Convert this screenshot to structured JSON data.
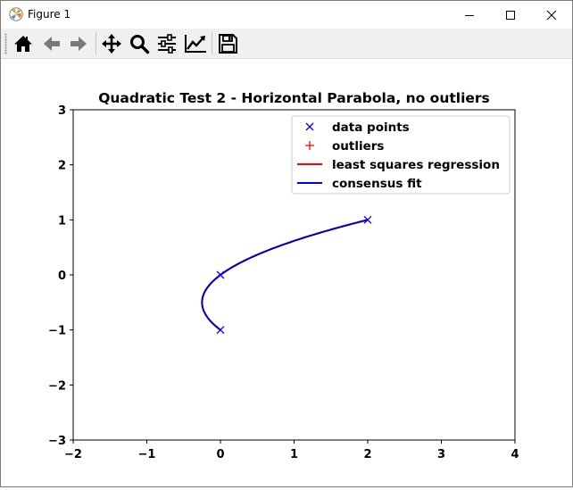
{
  "window": {
    "title": "Figure 1",
    "icons": {
      "app": "matplotlib-icon",
      "minimize": "minimize-icon",
      "maximize": "maximize-icon",
      "close": "close-icon"
    }
  },
  "toolbar": {
    "buttons": [
      {
        "name": "home",
        "icon": "home-icon"
      },
      {
        "name": "back",
        "icon": "arrow-left-icon"
      },
      {
        "name": "forward",
        "icon": "arrow-right-icon"
      },
      {
        "name": "pan",
        "icon": "move-icon"
      },
      {
        "name": "zoom",
        "icon": "zoom-icon"
      },
      {
        "name": "subplots",
        "icon": "sliders-icon"
      },
      {
        "name": "customize",
        "icon": "line-chart-icon"
      },
      {
        "name": "save",
        "icon": "save-icon"
      }
    ]
  },
  "chart_data": {
    "type": "scatter",
    "title": "Quadratic Test 2 - Horizontal Parabola, no outliers",
    "xlabel": "",
    "ylabel": "",
    "xlim": [
      -2,
      4
    ],
    "ylim": [
      -3,
      3
    ],
    "xticks": [
      -2,
      -1,
      0,
      1,
      2,
      3,
      4
    ],
    "yticks": [
      -3,
      -2,
      -1,
      0,
      1,
      2,
      3
    ],
    "xtick_labels": [
      "−2",
      "−1",
      "0",
      "1",
      "2",
      "3",
      "4"
    ],
    "ytick_labels": [
      "−3",
      "−2",
      "−1",
      "0",
      "1",
      "2",
      "3"
    ],
    "grid": false,
    "legend_position": "top-right",
    "legend": [
      {
        "label": "data points",
        "marker": "x",
        "color": "#0000ff"
      },
      {
        "label": "outliers",
        "marker": "+",
        "color": "#ff0000"
      },
      {
        "label": "least squares regression",
        "marker": "line",
        "color": "#ff0000"
      },
      {
        "label": "consensus fit",
        "marker": "line",
        "color": "#0000ff"
      }
    ],
    "data_points": {
      "x": [
        0,
        0,
        2
      ],
      "y": [
        -1,
        0,
        1
      ]
    },
    "outliers": {
      "x": [],
      "y": []
    },
    "curve": {
      "description_equation": "x = y^2 + y",
      "y_range": [
        -1,
        1
      ],
      "colors": {
        "least_squares": "#ff0000",
        "consensus": "#0000cc"
      }
    }
  }
}
